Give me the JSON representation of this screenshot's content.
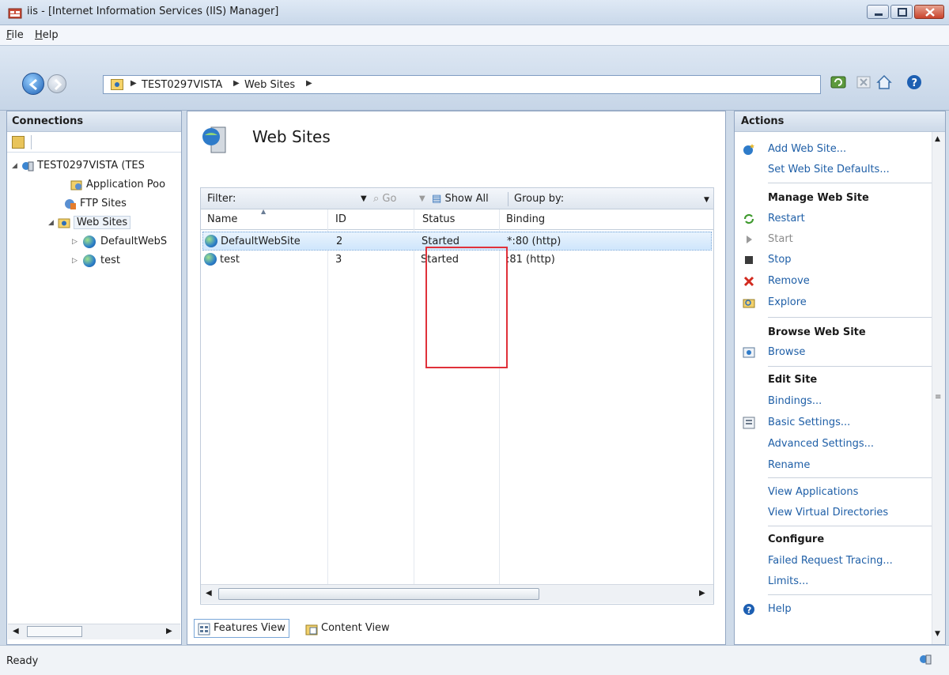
{
  "window": {
    "title": "iis - [Internet Information Services (IIS) Manager]"
  },
  "menu": [
    {
      "label": "File",
      "accel": "F"
    },
    {
      "label": "Help",
      "accel": "H"
    }
  ],
  "address": {
    "crumbs": [
      "TEST0297VISTA",
      "Web Sites"
    ]
  },
  "connections": {
    "header": "Connections",
    "tree": [
      {
        "label": "TEST0297VISTA (TES",
        "level": 0,
        "expander": "open"
      },
      {
        "label": "Application Poo",
        "level": 1,
        "expander": "none"
      },
      {
        "label": "FTP Sites",
        "level": 1,
        "expander": "none"
      },
      {
        "label": "Web Sites",
        "level": 1,
        "expander": "open",
        "selected": true
      },
      {
        "label": "DefaultWebS",
        "level": 2,
        "expander": "closed"
      },
      {
        "label": "test",
        "level": 2,
        "expander": "closed"
      }
    ]
  },
  "main": {
    "title": "Web Sites",
    "filter": {
      "label": "Filter:",
      "go": "Go",
      "show_all": "Show All",
      "group_by": "Group by:"
    },
    "columns": [
      "Name",
      "ID",
      "Status",
      "Binding"
    ],
    "rows": [
      {
        "name": "DefaultWebSite",
        "id": "2",
        "status": "Started",
        "binding": "*:80 (http)",
        "selected": true
      },
      {
        "name": "test",
        "id": "3",
        "status": "Started",
        "binding": ":81 (http)",
        "selected": false
      }
    ],
    "view_tabs": [
      "Features View",
      "Content View"
    ]
  },
  "actions": {
    "header": "Actions",
    "items": [
      {
        "type": "link",
        "label": "Add Web Site...",
        "icon": "globe-add-icon"
      },
      {
        "type": "link",
        "label": "Set Web Site Defaults...",
        "icon": ""
      },
      {
        "type": "section",
        "label": "Manage Web Site"
      },
      {
        "type": "link",
        "label": "Restart",
        "icon": "restart-icon"
      },
      {
        "type": "link",
        "label": "Start",
        "icon": "start-icon",
        "disabled": true
      },
      {
        "type": "link",
        "label": "Stop",
        "icon": "stop-icon"
      },
      {
        "type": "link",
        "label": "Remove",
        "icon": "remove-icon"
      },
      {
        "type": "link",
        "label": "Explore",
        "icon": "explore-icon"
      },
      {
        "type": "section",
        "label": "Browse Web Site"
      },
      {
        "type": "link",
        "label": "Browse",
        "icon": "browse-icon"
      },
      {
        "type": "section",
        "label": "Edit Site"
      },
      {
        "type": "link",
        "label": "Bindings...",
        "icon": ""
      },
      {
        "type": "link",
        "label": "Basic Settings...",
        "icon": "settings-icon"
      },
      {
        "type": "link",
        "label": "Advanced Settings...",
        "icon": ""
      },
      {
        "type": "link",
        "label": "Rename",
        "icon": ""
      },
      {
        "type": "divider"
      },
      {
        "type": "link",
        "label": "View Applications",
        "icon": ""
      },
      {
        "type": "link",
        "label": "View Virtual Directories",
        "icon": ""
      },
      {
        "type": "section",
        "label": "Configure"
      },
      {
        "type": "link",
        "label": "Failed Request Tracing...",
        "icon": ""
      },
      {
        "type": "link",
        "label": "Limits...",
        "icon": ""
      },
      {
        "type": "divider"
      },
      {
        "type": "link",
        "label": "Help",
        "icon": "help-icon"
      }
    ]
  },
  "statusbar": {
    "text": "Ready"
  },
  "colors": {
    "link": "#1f5fa7",
    "highlight_box": "#e0313a",
    "selection": "#cfe6fc"
  }
}
